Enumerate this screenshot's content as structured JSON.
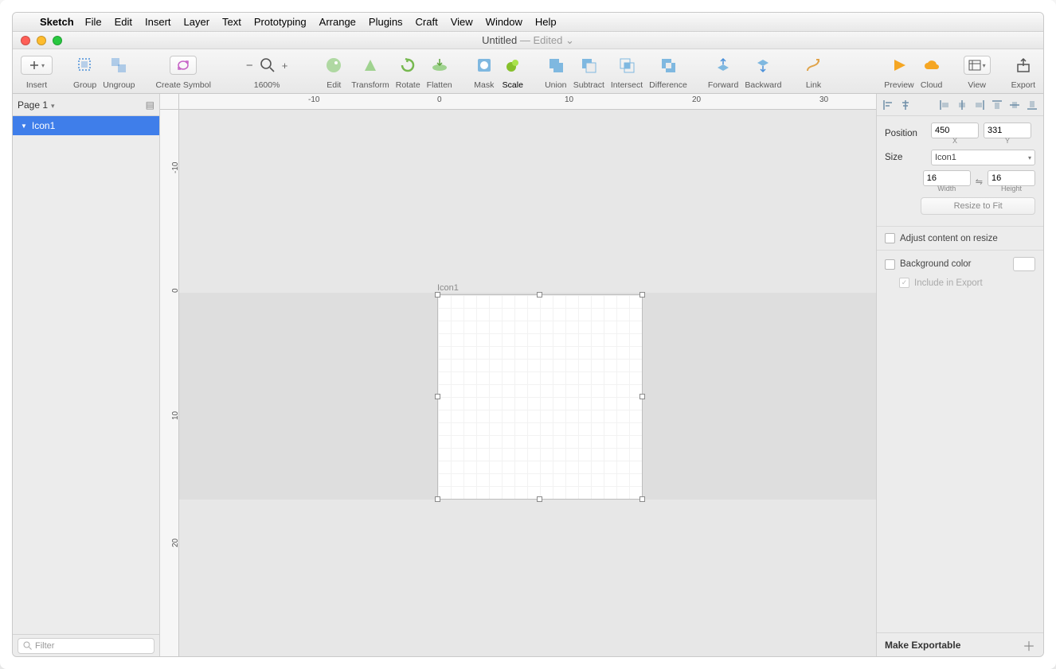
{
  "menu": {
    "app": "Sketch",
    "items": [
      "File",
      "Edit",
      "Insert",
      "Layer",
      "Text",
      "Prototyping",
      "Arrange",
      "Plugins",
      "Craft",
      "View",
      "Window",
      "Help"
    ]
  },
  "window": {
    "title": "Untitled",
    "edited": " — Edited",
    "chevron": "⌄"
  },
  "toolbar": {
    "insert": "Insert",
    "group": "Group",
    "ungroup": "Ungroup",
    "create_symbol": "Create Symbol",
    "zoom": "1600%",
    "edit": "Edit",
    "transform": "Transform",
    "rotate": "Rotate",
    "flatten": "Flatten",
    "mask": "Mask",
    "scale": "Scale",
    "union": "Union",
    "subtract": "Subtract",
    "intersect": "Intersect",
    "difference": "Difference",
    "forward": "Forward",
    "backward": "Backward",
    "link": "Link",
    "preview": "Preview",
    "cloud": "Cloud",
    "view": "View",
    "export": "Export"
  },
  "pages": {
    "current": "Page 1"
  },
  "layers": {
    "item0": "Icon1"
  },
  "filter": {
    "placeholder": "Filter"
  },
  "ruler_h": {
    "m10": "-10",
    "p0": "0",
    "p10": "10",
    "p20": "20",
    "p30": "30"
  },
  "ruler_v": {
    "m10": "-10",
    "p0": "0",
    "p10": "10",
    "p20": "20"
  },
  "canvas": {
    "artboard_label": "Icon1"
  },
  "inspector": {
    "position_label": "Position",
    "x": "450",
    "x_label": "X",
    "y": "331",
    "y_label": "Y",
    "size_label": "Size",
    "size_preset": "Icon1",
    "width": "16",
    "width_label": "Width",
    "height": "16",
    "height_label": "Height",
    "lock": "⇋",
    "resize_to_fit": "Resize to Fit",
    "adjust_content": "Adjust content on resize",
    "background_color": "Background color",
    "include_export": "Include in Export",
    "make_exportable": "Make Exportable"
  }
}
